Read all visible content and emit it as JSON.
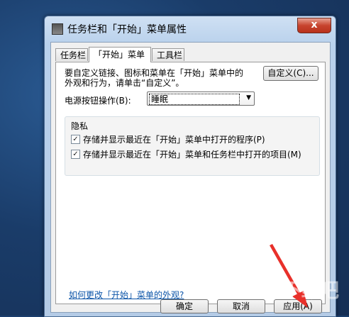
{
  "window": {
    "title": "任务栏和「开始」菜单属性",
    "close_label": "x"
  },
  "tabs": [
    {
      "label": "任务栏",
      "active": false
    },
    {
      "label": "「开始」菜单",
      "active": true
    },
    {
      "label": "工具栏",
      "active": false
    }
  ],
  "start_menu": {
    "description_line1": "要自定义链接、图标和菜单在「开始」菜单中的",
    "description_line2": "外观和行为，请单击“自定义”。",
    "customize_label": "自定义(C)...",
    "power_label": "电源按钮操作(B):",
    "power_value": "睡眠",
    "privacy_title": "隐私",
    "checkbox1_label": "存储并显示最近在「开始」菜单中打开的程序(P)",
    "checkbox1_checked": true,
    "checkbox2_label": "存储并显示最近在「开始」菜单和任务栏中打开的项目(M)",
    "checkbox2_checked": true,
    "link_text": "如何更改「开始」菜单的外观?"
  },
  "buttons": {
    "ok": "确定",
    "cancel": "取消",
    "apply": "应用(A)"
  },
  "icons": {
    "check_mark": "✓",
    "dropdown": "▼"
  },
  "colors": {
    "link": "#0b54a8",
    "annotation_arrow": "#e8302a"
  }
}
